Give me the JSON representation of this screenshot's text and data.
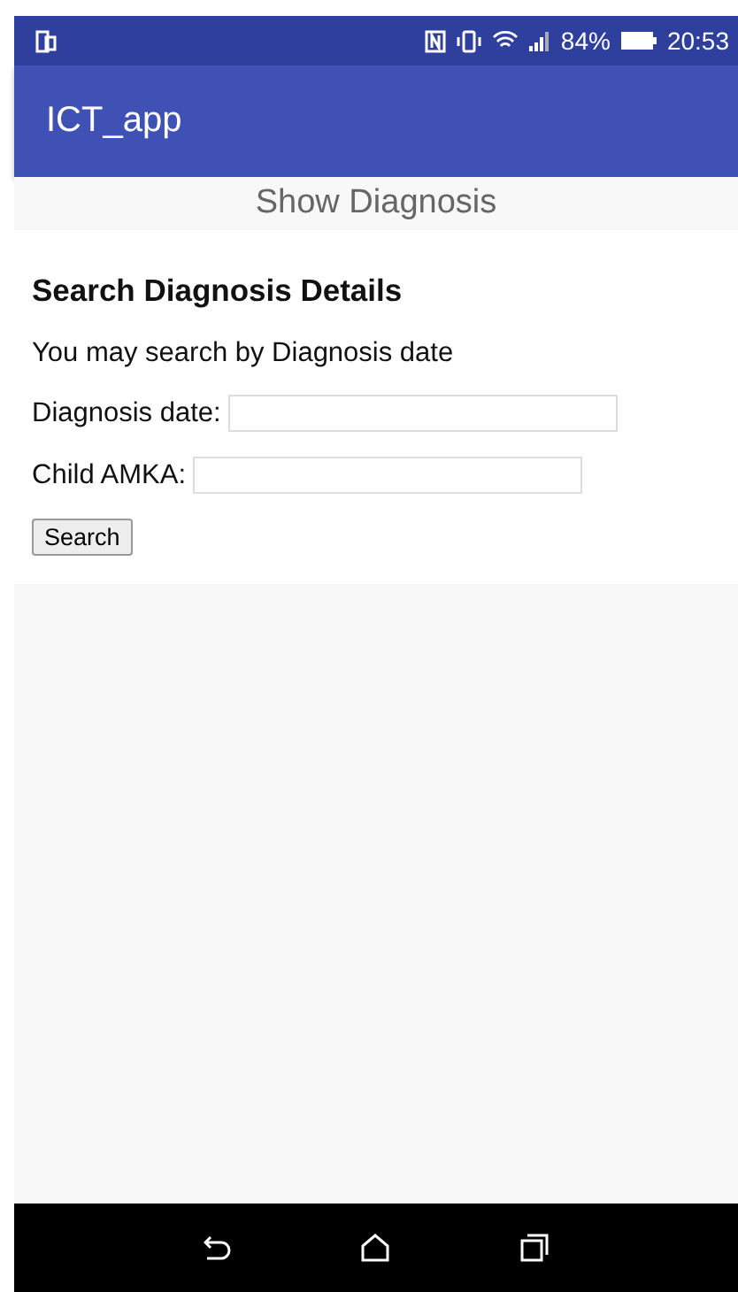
{
  "status_bar": {
    "battery": "84%",
    "time": "20:53"
  },
  "app_bar": {
    "title": "ICT_app"
  },
  "page_title": "Show Diagnosis",
  "form": {
    "heading": "Search Diagnosis Details",
    "hint": "You may search by Diagnosis date",
    "fields": [
      {
        "label": "Diagnosis date:"
      },
      {
        "label": "Child AMKA:"
      }
    ],
    "button": "Search"
  }
}
